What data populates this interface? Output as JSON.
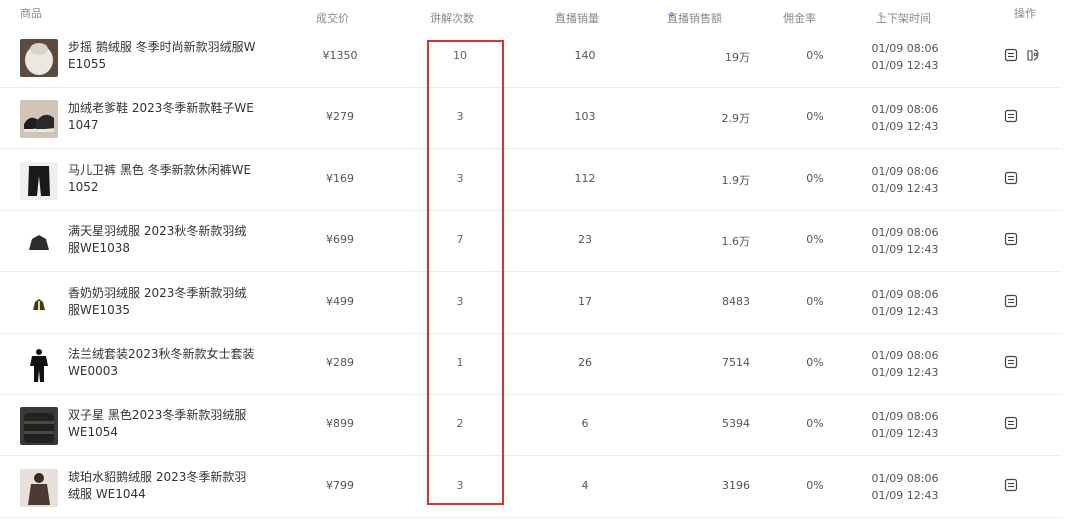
{
  "header": {
    "product": "商品",
    "price": "成交价",
    "explain_count": "讲解次数",
    "live_sales": "直播销量",
    "live_amount": "直播销售额",
    "commission": "佣金率",
    "shelf_time": "上下架时间",
    "action": "操作",
    "sort_glyph": "≑"
  },
  "colors": {
    "accent": "#4a6ef2",
    "highlight_border": "#e0302b"
  },
  "rows": [
    {
      "name": "步摇 鹅绒服 冬季时尚新款羽绒服WE1055",
      "price": "¥1350",
      "explain_count": "10",
      "live_sales": "140",
      "live_amount": "19万",
      "commission": "0%",
      "time_on": "01/09 08:06",
      "time_off": "01/09 12:43",
      "thumb_icon": "white-puffer-jacket-thumbnail",
      "has_extra_icon": true
    },
    {
      "name": "加绒老爹鞋 2023冬季新款鞋子WE1047",
      "price": "¥279",
      "explain_count": "3",
      "live_sales": "103",
      "live_amount": "2.9万",
      "commission": "0%",
      "time_on": "01/09 08:06",
      "time_off": "01/09 12:43",
      "thumb_icon": "black-sneakers-thumbnail",
      "has_extra_icon": false
    },
    {
      "name": "马儿卫裤 黑色 冬季新款休闲裤WE1052",
      "price": "¥169",
      "explain_count": "3",
      "live_sales": "112",
      "live_amount": "1.9万",
      "commission": "0%",
      "time_on": "01/09 08:06",
      "time_off": "01/09 12:43",
      "thumb_icon": "black-sweatpants-thumbnail",
      "has_extra_icon": false
    },
    {
      "name": "满天星羽绒服 2023秋冬新款羽绒服WE1038",
      "price": "¥699",
      "explain_count": "7",
      "live_sales": "23",
      "live_amount": "1.6万",
      "commission": "0%",
      "time_on": "01/09 08:06",
      "time_off": "01/09 12:43",
      "thumb_icon": "dark-jacket-thumbnail",
      "has_extra_icon": false
    },
    {
      "name": "香奶奶羽绒服 2023冬季新款羽绒服WE1035",
      "price": "¥499",
      "explain_count": "3",
      "live_sales": "17",
      "live_amount": "8483",
      "commission": "0%",
      "time_on": "01/09 08:06",
      "time_off": "01/09 12:43",
      "thumb_icon": "small-jacket-thumbnail",
      "has_extra_icon": false
    },
    {
      "name": "法兰绒套装2023秋冬新款女士套装WE0003",
      "price": "¥289",
      "explain_count": "1",
      "live_sales": "26",
      "live_amount": "7514",
      "commission": "0%",
      "time_on": "01/09 08:06",
      "time_off": "01/09 12:43",
      "thumb_icon": "black-outfit-thumbnail",
      "has_extra_icon": false
    },
    {
      "name": "双子星 黑色2023冬季新款羽绒服WE1054",
      "price": "¥899",
      "explain_count": "2",
      "live_sales": "6",
      "live_amount": "5394",
      "commission": "0%",
      "time_on": "01/09 08:06",
      "time_off": "01/09 12:43",
      "thumb_icon": "black-down-coat-thumbnail",
      "has_extra_icon": false
    },
    {
      "name": "琥珀水貂鹅绒服 2023冬季新款羽绒服 WE1044",
      "price": "¥799",
      "explain_count": "3",
      "live_sales": "4",
      "live_amount": "3196",
      "commission": "0%",
      "time_on": "01/09 08:06",
      "time_off": "01/09 12:43",
      "thumb_icon": "brown-coat-model-thumbnail",
      "has_extra_icon": false
    }
  ]
}
